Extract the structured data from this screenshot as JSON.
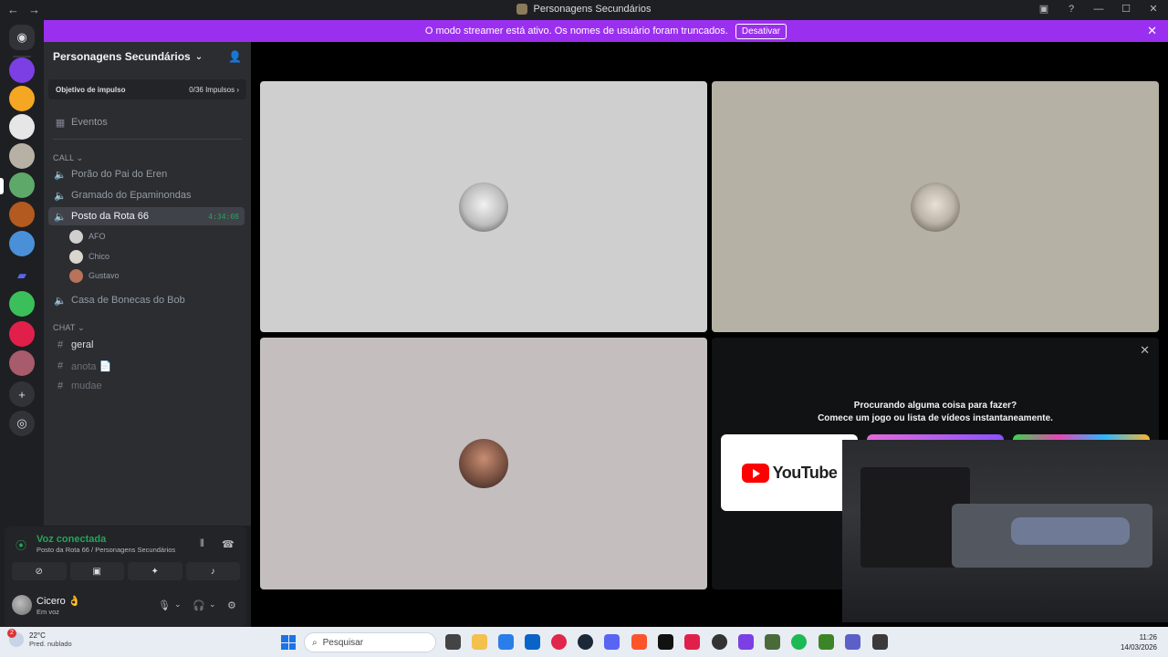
{
  "window": {
    "title": "Personagens Secundários",
    "nav_back": "←",
    "nav_forward": "→",
    "help_icon": "?",
    "minimize": "—",
    "maximize": "☐",
    "close": "✕"
  },
  "streamer_banner": {
    "text": "O modo streamer está ativo. Os nomes de usuário foram truncados.",
    "button": "Desativar",
    "close": "✕"
  },
  "server": {
    "name": "Personagens Secundários",
    "chevron": "⌄",
    "boost_label": "Objetivo de impulso",
    "boost_value": "0/36 Impulsos",
    "boost_chevron": "›",
    "events_label": "Eventos"
  },
  "categories": {
    "call": "CALL",
    "chat": "CHAT"
  },
  "voice_channels": [
    {
      "label": "Porão do Pai do Eren"
    },
    {
      "label": "Gramado do Epaminondas"
    },
    {
      "label": "Posto da Rota 66",
      "timer": "4:34:08"
    },
    {
      "label": "Casa de Bonecas do Bob"
    }
  ],
  "members": [
    {
      "name": "AFO"
    },
    {
      "name": "Chico"
    },
    {
      "name": "Gustavo"
    }
  ],
  "text_channels": [
    {
      "label": "geral"
    },
    {
      "label": "anota 📄"
    },
    {
      "label": "mudae"
    }
  ],
  "voice_panel": {
    "title": "Voz conectada",
    "subtitle": "Posto da Rota 66 / Personagens Secundários"
  },
  "user": {
    "name": "Cicero 👌",
    "status": "Em voz"
  },
  "activity": {
    "line1": "Procurando alguma coisa para fazer?",
    "line2": "Comece um jogo ou lista de vídeos instantaneamente.",
    "youtube": "YouTube",
    "close": "✕"
  },
  "taskbar": {
    "badge": "2",
    "temp": "22°C",
    "weather": "Pred. nublado",
    "search_placeholder": "Pesquisar",
    "time": "11:26",
    "date": "14/03/2026"
  },
  "colors": {
    "accent": "#9b2ff0",
    "online_green": "#23a55a",
    "sidebar_bg": "#2b2d31"
  }
}
